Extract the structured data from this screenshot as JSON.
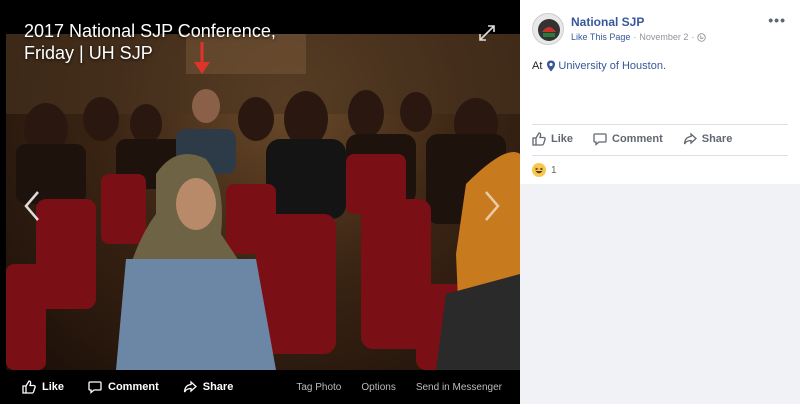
{
  "photo": {
    "title": "2017 National SJP Conference, Friday | UH SJP",
    "actions": {
      "like": "Like",
      "comment": "Comment",
      "share": "Share"
    },
    "links": {
      "tag": "Tag Photo",
      "options": "Options",
      "messenger": "Send in Messenger"
    }
  },
  "post": {
    "page_name": "National SJP",
    "like_page": "Like This Page",
    "dot": "·",
    "date": "November 2",
    "dot2": "·",
    "location_prefix": "At",
    "location": "University of Houston.",
    "actions": {
      "like": "Like",
      "comment": "Comment",
      "share": "Share"
    },
    "reaction_count": "1"
  },
  "colors": {
    "link": "#365899",
    "reaction": "#f7c84e",
    "annotation_arrow": "#e0332b"
  }
}
